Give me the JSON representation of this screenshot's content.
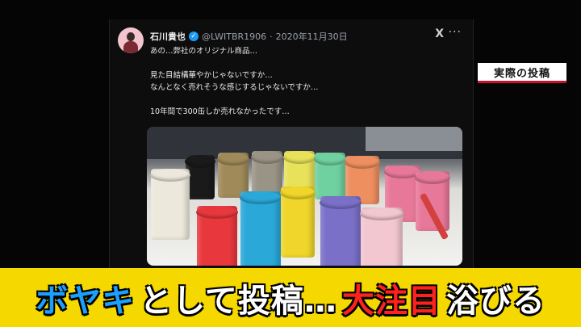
{
  "post": {
    "author_name": "石川貴也",
    "verified_mark": "✓",
    "handle": "@LWITBR1906",
    "separator": "·",
    "date": "2020年11月30日",
    "x_logo_icon": "x-logo-icon",
    "more_icon": "more-options-icon",
    "more_glyph": "···",
    "x_glyph": "X",
    "lines": [
      "あの…弊社のオリジナル商品…",
      "見た目結構華やかじゃないですか…",
      "なんとなく売れそうな感じするじゃないですか…",
      "10年間で300缶しか売れなかったです…"
    ]
  },
  "badge": {
    "label": "実際の投稿"
  },
  "caption": {
    "part1": "ボヤキ",
    "part2": "として投稿…",
    "part3": "大注目",
    "part4": "浴びる"
  },
  "colors": {
    "banner_bg": "#f4d800",
    "caption_blue": "#1ca0ff",
    "caption_red": "#ff2020",
    "badge_underline": "#c8102e",
    "verified_blue": "#1d9bf0",
    "can_colors": [
      "#ece8dc",
      "#1a1a1a",
      "#a08a5a",
      "#9a9486",
      "#e8e25a",
      "#6fd0a0",
      "#ee8f60",
      "#e8789a",
      "#e8383e",
      "#2aa8d8",
      "#f0d62a",
      "#7a70c8",
      "#f2c7cf"
    ]
  }
}
